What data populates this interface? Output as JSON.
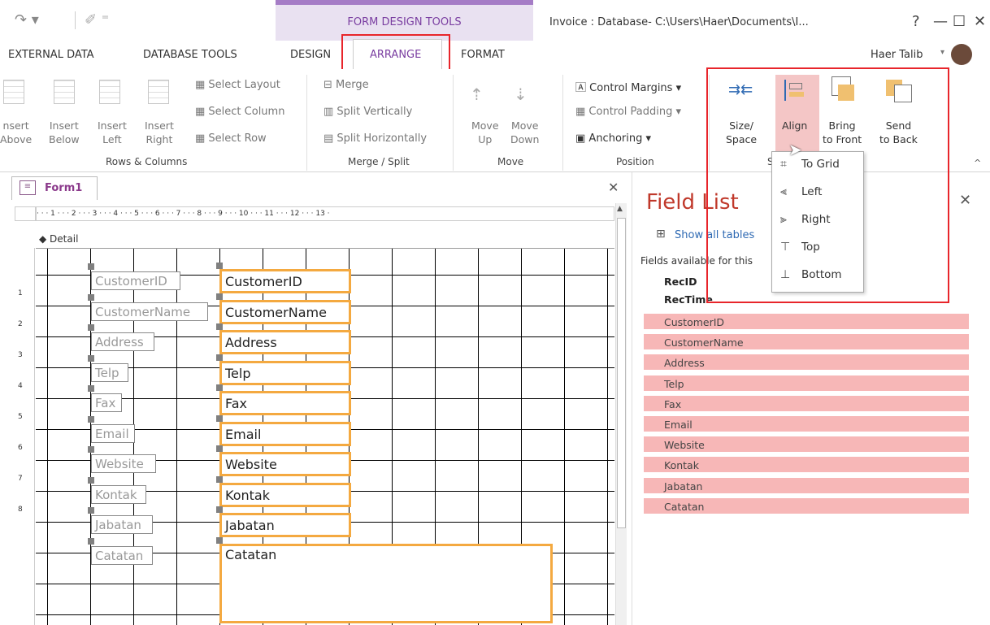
{
  "window": {
    "context_tab": "FORM DESIGN TOOLS",
    "title": "Invoice : Database- C:\\Users\\Haer\\Documents\\I...",
    "help": "?",
    "minimize": "—",
    "maximize": "☐",
    "close": "✕",
    "user": "Haer Talib"
  },
  "tabs": {
    "external_data": "EXTERNAL DATA",
    "database_tools": "DATABASE TOOLS",
    "design": "DESIGN",
    "arrange": "ARRANGE",
    "format": "FORMAT"
  },
  "ribbon": {
    "rows_columns": {
      "insert_above": [
        "nsert",
        "Above"
      ],
      "insert_below": [
        "Insert",
        "Below"
      ],
      "insert_left": [
        "Insert",
        "Left"
      ],
      "insert_right": [
        "Insert",
        "Right"
      ],
      "select_layout": "Select Layout",
      "select_column": "Select Column",
      "select_row": "Select Row",
      "group": "Rows & Columns"
    },
    "merge_split": {
      "merge": "Merge",
      "split_vertically": "Split Vertically",
      "split_horizontally": "Split Horizontally",
      "group": "Merge / Split"
    },
    "move": {
      "move_up": [
        "Move",
        "Up"
      ],
      "move_down": [
        "Move",
        "Down"
      ],
      "group": "Move"
    },
    "position": {
      "control_margins": "Control Margins",
      "control_padding": "Control Padding",
      "anchoring": "Anchoring",
      "group": "Position"
    },
    "sizing": {
      "size_space": [
        "Size/",
        "Space"
      ],
      "align": "Align",
      "bring_front": [
        "Bring",
        "to Front"
      ],
      "send_back": [
        "Send",
        "to Back"
      ],
      "group": "S"
    }
  },
  "align_menu": {
    "to_grid": "To Grid",
    "left": "Left",
    "right": "Right",
    "top": "Top",
    "bottom": "Bottom"
  },
  "document": {
    "tab": "Form1",
    "ruler": "· · · 1 · · · 2 · · · 3 · · · 4 · · · 5 · · · 6 · · · 7 · · · 8 · · · 9 · · · 10 · · · 11 · · · 12 · · · 13 ·",
    "section": "Detail",
    "labels": [
      "CustomerID",
      "CustomerName",
      "Address",
      "Telp",
      "Fax",
      "Email",
      "Website",
      "Kontak",
      "Jabatan",
      "Catatan"
    ],
    "textboxes": [
      "CustomerID",
      "CustomerName",
      "Address",
      "Telp",
      "Fax",
      "Email",
      "Website",
      "Kontak",
      "Jabatan",
      "Catatan"
    ],
    "vruler": [
      "1",
      "2",
      "3",
      "4",
      "5",
      "6",
      "7",
      "8"
    ]
  },
  "field_list": {
    "title": "Field List",
    "show_all": "Show all tables",
    "available": "Fields available for this",
    "bold_fields": [
      "RecID",
      "RecTime"
    ],
    "fields": [
      "CustomerID",
      "CustomerName",
      "Address",
      "Telp",
      "Fax",
      "Email",
      "Website",
      "Kontak",
      "Jabatan",
      "Catatan"
    ]
  },
  "colors": {
    "highlight": "#e8252b",
    "selection": "#f4a940",
    "field_row": "#f7b7b7",
    "context_band": "#e9e1f1"
  }
}
